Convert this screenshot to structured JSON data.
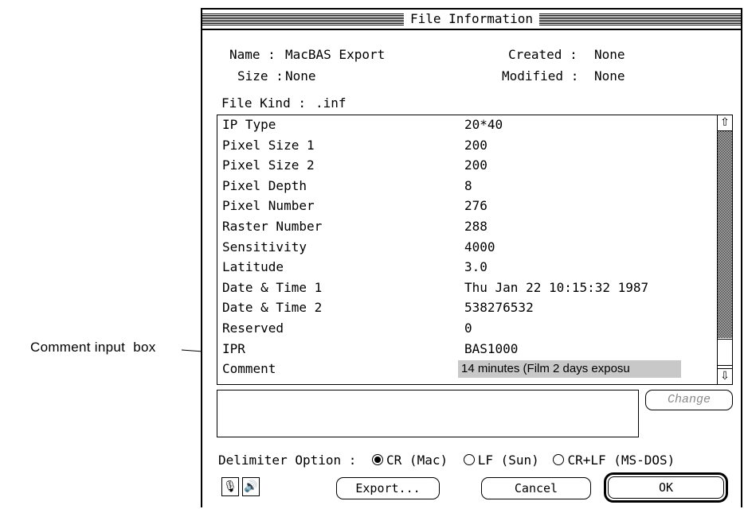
{
  "annotation": {
    "label": "Comment input  box"
  },
  "window": {
    "title": "File Information"
  },
  "file_info": {
    "name_label": "Name :",
    "name_value": "MacBAS Export",
    "size_label": "Size :",
    "size_value": "None",
    "created_label": "Created :",
    "created_value": "None",
    "modified_label": "Modified :",
    "modified_value": "None",
    "kind_label": "File Kind :",
    "kind_value": ".inf"
  },
  "fields": [
    {
      "key": "IP Type",
      "value": "20*40"
    },
    {
      "key": "Pixel Size 1",
      "value": "200"
    },
    {
      "key": "Pixel Size 2",
      "value": "200"
    },
    {
      "key": "Pixel Depth",
      "value": "8"
    },
    {
      "key": "Pixel Number",
      "value": "276"
    },
    {
      "key": "Raster Number",
      "value": "288"
    },
    {
      "key": "Sensitivity",
      "value": "4000"
    },
    {
      "key": "Latitude",
      "value": "3.0"
    },
    {
      "key": "Date & Time 1",
      "value": "Thu Jan 22 10:15:32 1987"
    },
    {
      "key": "Date & Time 2",
      "value": "538276532"
    },
    {
      "key": "Reserved",
      "value": "0"
    },
    {
      "key": "IPR",
      "value": "BAS1000"
    },
    {
      "key": "Comment",
      "value": "14 minutes (Film 2 days exposu"
    }
  ],
  "buttons": {
    "change": "Change",
    "export": "Export...",
    "cancel": "Cancel",
    "ok": "OK"
  },
  "delimiter": {
    "label": "Delimiter Option :",
    "options": [
      "CR (Mac)",
      "LF (Sun)",
      "CR+LF (MS-DOS)"
    ],
    "selected": "CR (Mac)"
  },
  "icons": {
    "scroll_up": "up-arrow-icon",
    "scroll_down": "down-arrow-icon",
    "microphone": "microphone-icon",
    "speaker": "speaker-icon"
  }
}
